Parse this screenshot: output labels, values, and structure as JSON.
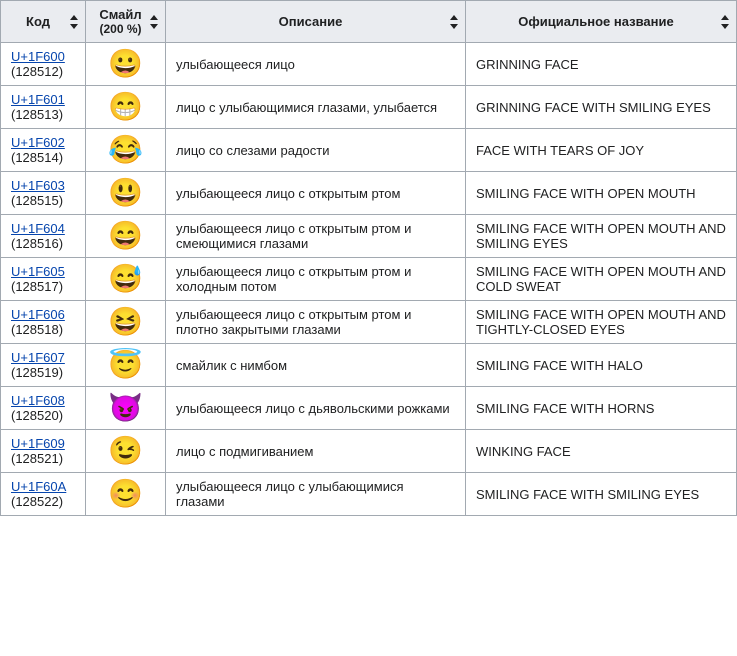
{
  "headers": {
    "code": "Код",
    "emoji": "Смайл",
    "emoji_sub": "(200 %)",
    "description": "Описание",
    "official_name": "Официальное название"
  },
  "rows": [
    {
      "code_hex": "U+1F600",
      "code_dec": "(128512)",
      "emoji": "😀",
      "description": "улыбающееся лицо",
      "official_name": "GRINNING FACE"
    },
    {
      "code_hex": "U+1F601",
      "code_dec": "(128513)",
      "emoji": "😁",
      "description": "лицо с улыбающимися глазами, улыбается",
      "official_name": "GRINNING FACE WITH SMILING EYES"
    },
    {
      "code_hex": "U+1F602",
      "code_dec": "(128514)",
      "emoji": "😂",
      "description": "лицо со слезами радости",
      "official_name": "FACE WITH TEARS OF JOY"
    },
    {
      "code_hex": "U+1F603",
      "code_dec": "(128515)",
      "emoji": "😃",
      "description": "улыбающееся лицо с открытым ртом",
      "official_name": "SMILING FACE WITH OPEN MOUTH"
    },
    {
      "code_hex": "U+1F604",
      "code_dec": "(128516)",
      "emoji": "😄",
      "description": "улыбающееся лицо с открытым ртом и смеющимися глазами",
      "official_name": "SMILING FACE WITH OPEN MOUTH AND SMILING EYES"
    },
    {
      "code_hex": "U+1F605",
      "code_dec": "(128517)",
      "emoji": "😅",
      "description": "улыбающееся лицо с открытым ртом и холодным потом",
      "official_name": "SMILING FACE WITH OPEN MOUTH AND COLD SWEAT"
    },
    {
      "code_hex": "U+1F606",
      "code_dec": "(128518)",
      "emoji": "😆",
      "description": "улыбающееся лицо с открытым ртом и плотно закрытыми глазами",
      "official_name": "SMILING FACE WITH OPEN MOUTH AND TIGHTLY-CLOSED EYES"
    },
    {
      "code_hex": "U+1F607",
      "code_dec": "(128519)",
      "emoji": "😇",
      "description": "смайлик с нимбом",
      "official_name": "SMILING FACE WITH HALO"
    },
    {
      "code_hex": "U+1F608",
      "code_dec": "(128520)",
      "emoji": "😈",
      "description": "улыбающееся лицо с дьявольскими рожками",
      "official_name": "SMILING FACE WITH HORNS"
    },
    {
      "code_hex": "U+1F609",
      "code_dec": "(128521)",
      "emoji": "😉",
      "description": "лицо с подмигиванием",
      "official_name": "WINKING FACE"
    },
    {
      "code_hex": "U+1F60A",
      "code_dec": "(128522)",
      "emoji": "😊",
      "description": "улыбающееся лицо с улыбающимися глазами",
      "official_name": "SMILING FACE WITH SMILING EYES"
    }
  ]
}
